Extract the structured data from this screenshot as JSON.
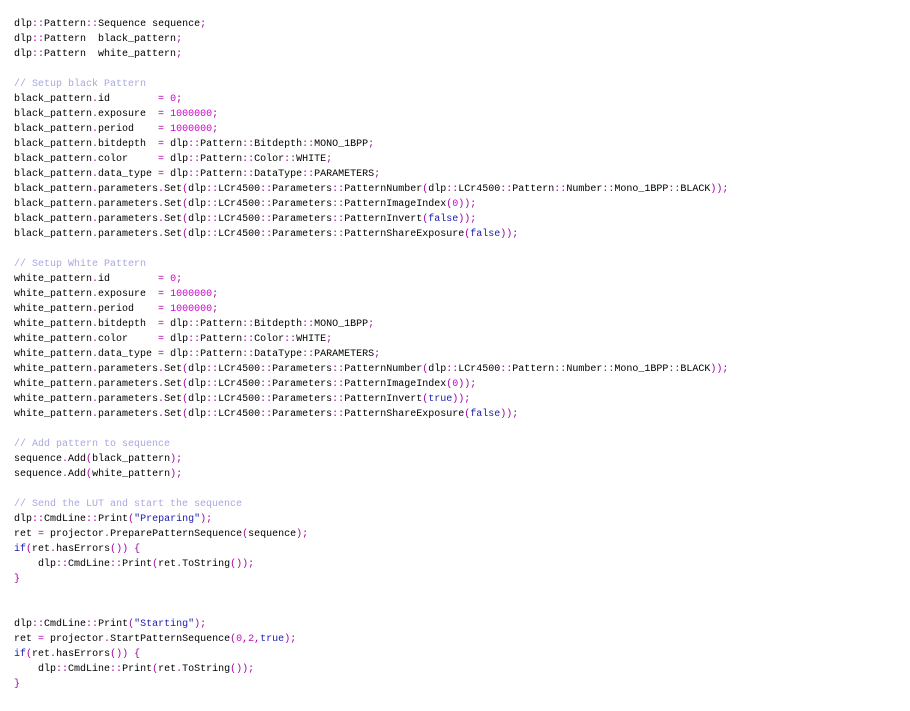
{
  "colors": {
    "plain": "#000000",
    "operator": "#a000a0",
    "number": "#cc00cc",
    "string": "#1a1ab0",
    "keyword": "#1a1ab0",
    "comment": "#a8a8e0",
    "background": "#ffffff"
  },
  "code_lines": [
    [
      [
        "p",
        "dlp"
      ],
      [
        "o",
        "::"
      ],
      [
        "p",
        "Pattern"
      ],
      [
        "o",
        "::"
      ],
      [
        "p",
        "Sequence sequence"
      ],
      [
        "o",
        ";"
      ]
    ],
    [
      [
        "p",
        "dlp"
      ],
      [
        "o",
        "::"
      ],
      [
        "p",
        "Pattern  black_pattern"
      ],
      [
        "o",
        ";"
      ]
    ],
    [
      [
        "p",
        "dlp"
      ],
      [
        "o",
        "::"
      ],
      [
        "p",
        "Pattern  white_pattern"
      ],
      [
        "o",
        ";"
      ]
    ],
    [],
    [
      [
        "c",
        "// Setup black Pattern"
      ]
    ],
    [
      [
        "p",
        "black_pattern"
      ],
      [
        "o",
        "."
      ],
      [
        "p",
        "id        "
      ],
      [
        "o",
        "="
      ],
      [
        "p",
        " "
      ],
      [
        "n",
        "0"
      ],
      [
        "o",
        ";"
      ]
    ],
    [
      [
        "p",
        "black_pattern"
      ],
      [
        "o",
        "."
      ],
      [
        "p",
        "exposure  "
      ],
      [
        "o",
        "="
      ],
      [
        "p",
        " "
      ],
      [
        "n",
        "1000000"
      ],
      [
        "o",
        ";"
      ]
    ],
    [
      [
        "p",
        "black_pattern"
      ],
      [
        "o",
        "."
      ],
      [
        "p",
        "period    "
      ],
      [
        "o",
        "="
      ],
      [
        "p",
        " "
      ],
      [
        "n",
        "1000000"
      ],
      [
        "o",
        ";"
      ]
    ],
    [
      [
        "p",
        "black_pattern"
      ],
      [
        "o",
        "."
      ],
      [
        "p",
        "bitdepth  "
      ],
      [
        "o",
        "="
      ],
      [
        "p",
        " dlp"
      ],
      [
        "o",
        "::"
      ],
      [
        "p",
        "Pattern"
      ],
      [
        "o",
        "::"
      ],
      [
        "p",
        "Bitdepth"
      ],
      [
        "o",
        "::"
      ],
      [
        "p",
        "MONO_1BPP"
      ],
      [
        "o",
        ";"
      ]
    ],
    [
      [
        "p",
        "black_pattern"
      ],
      [
        "o",
        "."
      ],
      [
        "p",
        "color     "
      ],
      [
        "o",
        "="
      ],
      [
        "p",
        " dlp"
      ],
      [
        "o",
        "::"
      ],
      [
        "p",
        "Pattern"
      ],
      [
        "o",
        "::"
      ],
      [
        "p",
        "Color"
      ],
      [
        "o",
        "::"
      ],
      [
        "p",
        "WHITE"
      ],
      [
        "o",
        ";"
      ]
    ],
    [
      [
        "p",
        "black_pattern"
      ],
      [
        "o",
        "."
      ],
      [
        "p",
        "data_type "
      ],
      [
        "o",
        "="
      ],
      [
        "p",
        " dlp"
      ],
      [
        "o",
        "::"
      ],
      [
        "p",
        "Pattern"
      ],
      [
        "o",
        "::"
      ],
      [
        "p",
        "DataType"
      ],
      [
        "o",
        "::"
      ],
      [
        "p",
        "PARAMETERS"
      ],
      [
        "o",
        ";"
      ]
    ],
    [
      [
        "p",
        "black_pattern"
      ],
      [
        "o",
        "."
      ],
      [
        "p",
        "parameters"
      ],
      [
        "o",
        "."
      ],
      [
        "p",
        "Set"
      ],
      [
        "o",
        "("
      ],
      [
        "p",
        "dlp"
      ],
      [
        "o",
        "::"
      ],
      [
        "p",
        "LCr4500"
      ],
      [
        "o",
        "::"
      ],
      [
        "p",
        "Parameters"
      ],
      [
        "o",
        "::"
      ],
      [
        "p",
        "PatternNumber"
      ],
      [
        "o",
        "("
      ],
      [
        "p",
        "dlp"
      ],
      [
        "o",
        "::"
      ],
      [
        "p",
        "LCr4500"
      ],
      [
        "o",
        "::"
      ],
      [
        "p",
        "Pattern"
      ],
      [
        "o",
        "::"
      ],
      [
        "p",
        "Number"
      ],
      [
        "o",
        "::"
      ],
      [
        "p",
        "Mono_1BPP"
      ],
      [
        "o",
        "::"
      ],
      [
        "p",
        "BLACK"
      ],
      [
        "o",
        "));"
      ]
    ],
    [
      [
        "p",
        "black_pattern"
      ],
      [
        "o",
        "."
      ],
      [
        "p",
        "parameters"
      ],
      [
        "o",
        "."
      ],
      [
        "p",
        "Set"
      ],
      [
        "o",
        "("
      ],
      [
        "p",
        "dlp"
      ],
      [
        "o",
        "::"
      ],
      [
        "p",
        "LCr4500"
      ],
      [
        "o",
        "::"
      ],
      [
        "p",
        "Parameters"
      ],
      [
        "o",
        "::"
      ],
      [
        "p",
        "PatternImageIndex"
      ],
      [
        "o",
        "("
      ],
      [
        "n",
        "0"
      ],
      [
        "o",
        "));"
      ]
    ],
    [
      [
        "p",
        "black_pattern"
      ],
      [
        "o",
        "."
      ],
      [
        "p",
        "parameters"
      ],
      [
        "o",
        "."
      ],
      [
        "p",
        "Set"
      ],
      [
        "o",
        "("
      ],
      [
        "p",
        "dlp"
      ],
      [
        "o",
        "::"
      ],
      [
        "p",
        "LCr4500"
      ],
      [
        "o",
        "::"
      ],
      [
        "p",
        "Parameters"
      ],
      [
        "o",
        "::"
      ],
      [
        "p",
        "PatternInvert"
      ],
      [
        "o",
        "("
      ],
      [
        "b",
        "false"
      ],
      [
        "o",
        "));"
      ]
    ],
    [
      [
        "p",
        "black_pattern"
      ],
      [
        "o",
        "."
      ],
      [
        "p",
        "parameters"
      ],
      [
        "o",
        "."
      ],
      [
        "p",
        "Set"
      ],
      [
        "o",
        "("
      ],
      [
        "p",
        "dlp"
      ],
      [
        "o",
        "::"
      ],
      [
        "p",
        "LCr4500"
      ],
      [
        "o",
        "::"
      ],
      [
        "p",
        "Parameters"
      ],
      [
        "o",
        "::"
      ],
      [
        "p",
        "PatternShareExposure"
      ],
      [
        "o",
        "("
      ],
      [
        "b",
        "false"
      ],
      [
        "o",
        "));"
      ]
    ],
    [],
    [
      [
        "c",
        "// Setup White Pattern"
      ]
    ],
    [
      [
        "p",
        "white_pattern"
      ],
      [
        "o",
        "."
      ],
      [
        "p",
        "id        "
      ],
      [
        "o",
        "="
      ],
      [
        "p",
        " "
      ],
      [
        "n",
        "0"
      ],
      [
        "o",
        ";"
      ]
    ],
    [
      [
        "p",
        "white_pattern"
      ],
      [
        "o",
        "."
      ],
      [
        "p",
        "exposure  "
      ],
      [
        "o",
        "="
      ],
      [
        "p",
        " "
      ],
      [
        "n",
        "1000000"
      ],
      [
        "o",
        ";"
      ]
    ],
    [
      [
        "p",
        "white_pattern"
      ],
      [
        "o",
        "."
      ],
      [
        "p",
        "period    "
      ],
      [
        "o",
        "="
      ],
      [
        "p",
        " "
      ],
      [
        "n",
        "1000000"
      ],
      [
        "o",
        ";"
      ]
    ],
    [
      [
        "p",
        "white_pattern"
      ],
      [
        "o",
        "."
      ],
      [
        "p",
        "bitdepth  "
      ],
      [
        "o",
        "="
      ],
      [
        "p",
        " dlp"
      ],
      [
        "o",
        "::"
      ],
      [
        "p",
        "Pattern"
      ],
      [
        "o",
        "::"
      ],
      [
        "p",
        "Bitdepth"
      ],
      [
        "o",
        "::"
      ],
      [
        "p",
        "MONO_1BPP"
      ],
      [
        "o",
        ";"
      ]
    ],
    [
      [
        "p",
        "white_pattern"
      ],
      [
        "o",
        "."
      ],
      [
        "p",
        "color     "
      ],
      [
        "o",
        "="
      ],
      [
        "p",
        " dlp"
      ],
      [
        "o",
        "::"
      ],
      [
        "p",
        "Pattern"
      ],
      [
        "o",
        "::"
      ],
      [
        "p",
        "Color"
      ],
      [
        "o",
        "::"
      ],
      [
        "p",
        "WHITE"
      ],
      [
        "o",
        ";"
      ]
    ],
    [
      [
        "p",
        "white_pattern"
      ],
      [
        "o",
        "."
      ],
      [
        "p",
        "data_type "
      ],
      [
        "o",
        "="
      ],
      [
        "p",
        " dlp"
      ],
      [
        "o",
        "::"
      ],
      [
        "p",
        "Pattern"
      ],
      [
        "o",
        "::"
      ],
      [
        "p",
        "DataType"
      ],
      [
        "o",
        "::"
      ],
      [
        "p",
        "PARAMETERS"
      ],
      [
        "o",
        ";"
      ]
    ],
    [
      [
        "p",
        "white_pattern"
      ],
      [
        "o",
        "."
      ],
      [
        "p",
        "parameters"
      ],
      [
        "o",
        "."
      ],
      [
        "p",
        "Set"
      ],
      [
        "o",
        "("
      ],
      [
        "p",
        "dlp"
      ],
      [
        "o",
        "::"
      ],
      [
        "p",
        "LCr4500"
      ],
      [
        "o",
        "::"
      ],
      [
        "p",
        "Parameters"
      ],
      [
        "o",
        "::"
      ],
      [
        "p",
        "PatternNumber"
      ],
      [
        "o",
        "("
      ],
      [
        "p",
        "dlp"
      ],
      [
        "o",
        "::"
      ],
      [
        "p",
        "LCr4500"
      ],
      [
        "o",
        "::"
      ],
      [
        "p",
        "Pattern"
      ],
      [
        "o",
        "::"
      ],
      [
        "p",
        "Number"
      ],
      [
        "o",
        "::"
      ],
      [
        "p",
        "Mono_1BPP"
      ],
      [
        "o",
        "::"
      ],
      [
        "p",
        "BLACK"
      ],
      [
        "o",
        "));"
      ]
    ],
    [
      [
        "p",
        "white_pattern"
      ],
      [
        "o",
        "."
      ],
      [
        "p",
        "parameters"
      ],
      [
        "o",
        "."
      ],
      [
        "p",
        "Set"
      ],
      [
        "o",
        "("
      ],
      [
        "p",
        "dlp"
      ],
      [
        "o",
        "::"
      ],
      [
        "p",
        "LCr4500"
      ],
      [
        "o",
        "::"
      ],
      [
        "p",
        "Parameters"
      ],
      [
        "o",
        "::"
      ],
      [
        "p",
        "PatternImageIndex"
      ],
      [
        "o",
        "("
      ],
      [
        "n",
        "0"
      ],
      [
        "o",
        "));"
      ]
    ],
    [
      [
        "p",
        "white_pattern"
      ],
      [
        "o",
        "."
      ],
      [
        "p",
        "parameters"
      ],
      [
        "o",
        "."
      ],
      [
        "p",
        "Set"
      ],
      [
        "o",
        "("
      ],
      [
        "p",
        "dlp"
      ],
      [
        "o",
        "::"
      ],
      [
        "p",
        "LCr4500"
      ],
      [
        "o",
        "::"
      ],
      [
        "p",
        "Parameters"
      ],
      [
        "o",
        "::"
      ],
      [
        "p",
        "PatternInvert"
      ],
      [
        "o",
        "("
      ],
      [
        "b",
        "true"
      ],
      [
        "o",
        "));"
      ]
    ],
    [
      [
        "p",
        "white_pattern"
      ],
      [
        "o",
        "."
      ],
      [
        "p",
        "parameters"
      ],
      [
        "o",
        "."
      ],
      [
        "p",
        "Set"
      ],
      [
        "o",
        "("
      ],
      [
        "p",
        "dlp"
      ],
      [
        "o",
        "::"
      ],
      [
        "p",
        "LCr4500"
      ],
      [
        "o",
        "::"
      ],
      [
        "p",
        "Parameters"
      ],
      [
        "o",
        "::"
      ],
      [
        "p",
        "PatternShareExposure"
      ],
      [
        "o",
        "("
      ],
      [
        "b",
        "false"
      ],
      [
        "o",
        "));"
      ]
    ],
    [],
    [
      [
        "c",
        "// Add pattern to sequence"
      ]
    ],
    [
      [
        "p",
        "sequence"
      ],
      [
        "o",
        "."
      ],
      [
        "p",
        "Add"
      ],
      [
        "o",
        "("
      ],
      [
        "p",
        "black_pattern"
      ],
      [
        "o",
        ");"
      ]
    ],
    [
      [
        "p",
        "sequence"
      ],
      [
        "o",
        "."
      ],
      [
        "p",
        "Add"
      ],
      [
        "o",
        "("
      ],
      [
        "p",
        "white_pattern"
      ],
      [
        "o",
        ");"
      ]
    ],
    [],
    [
      [
        "c",
        "// Send the LUT and start the sequence"
      ]
    ],
    [
      [
        "p",
        "dlp"
      ],
      [
        "o",
        "::"
      ],
      [
        "p",
        "CmdLine"
      ],
      [
        "o",
        "::"
      ],
      [
        "p",
        "Print"
      ],
      [
        "o",
        "("
      ],
      [
        "s",
        "\"Preparing\""
      ],
      [
        "o",
        ");"
      ]
    ],
    [
      [
        "p",
        "ret "
      ],
      [
        "o",
        "="
      ],
      [
        "p",
        " projector"
      ],
      [
        "o",
        "."
      ],
      [
        "p",
        "PreparePatternSequence"
      ],
      [
        "o",
        "("
      ],
      [
        "p",
        "sequence"
      ],
      [
        "o",
        ");"
      ]
    ],
    [
      [
        "k",
        "if"
      ],
      [
        "o",
        "("
      ],
      [
        "p",
        "ret"
      ],
      [
        "o",
        "."
      ],
      [
        "p",
        "hasErrors"
      ],
      [
        "o",
        "())"
      ],
      [
        "p",
        " "
      ],
      [
        "o",
        "{"
      ]
    ],
    [
      [
        "p",
        "    dlp"
      ],
      [
        "o",
        "::"
      ],
      [
        "p",
        "CmdLine"
      ],
      [
        "o",
        "::"
      ],
      [
        "p",
        "Print"
      ],
      [
        "o",
        "("
      ],
      [
        "p",
        "ret"
      ],
      [
        "o",
        "."
      ],
      [
        "p",
        "ToString"
      ],
      [
        "o",
        "());"
      ]
    ],
    [
      [
        "o",
        "}"
      ]
    ],
    [],
    [],
    [
      [
        "p",
        "dlp"
      ],
      [
        "o",
        "::"
      ],
      [
        "p",
        "CmdLine"
      ],
      [
        "o",
        "::"
      ],
      [
        "p",
        "Print"
      ],
      [
        "o",
        "("
      ],
      [
        "s",
        "\"Starting\""
      ],
      [
        "o",
        ");"
      ]
    ],
    [
      [
        "p",
        "ret "
      ],
      [
        "o",
        "="
      ],
      [
        "p",
        " projector"
      ],
      [
        "o",
        "."
      ],
      [
        "p",
        "StartPatternSequence"
      ],
      [
        "o",
        "("
      ],
      [
        "n",
        "0"
      ],
      [
        "o",
        ","
      ],
      [
        "n",
        "2"
      ],
      [
        "o",
        ","
      ],
      [
        "b",
        "true"
      ],
      [
        "o",
        ");"
      ]
    ],
    [
      [
        "k",
        "if"
      ],
      [
        "o",
        "("
      ],
      [
        "p",
        "ret"
      ],
      [
        "o",
        "."
      ],
      [
        "p",
        "hasErrors"
      ],
      [
        "o",
        "())"
      ],
      [
        "p",
        " "
      ],
      [
        "o",
        "{"
      ]
    ],
    [
      [
        "p",
        "    dlp"
      ],
      [
        "o",
        "::"
      ],
      [
        "p",
        "CmdLine"
      ],
      [
        "o",
        "::"
      ],
      [
        "p",
        "Print"
      ],
      [
        "o",
        "("
      ],
      [
        "p",
        "ret"
      ],
      [
        "o",
        "."
      ],
      [
        "p",
        "ToString"
      ],
      [
        "o",
        "());"
      ]
    ],
    [
      [
        "o",
        "}"
      ]
    ]
  ]
}
